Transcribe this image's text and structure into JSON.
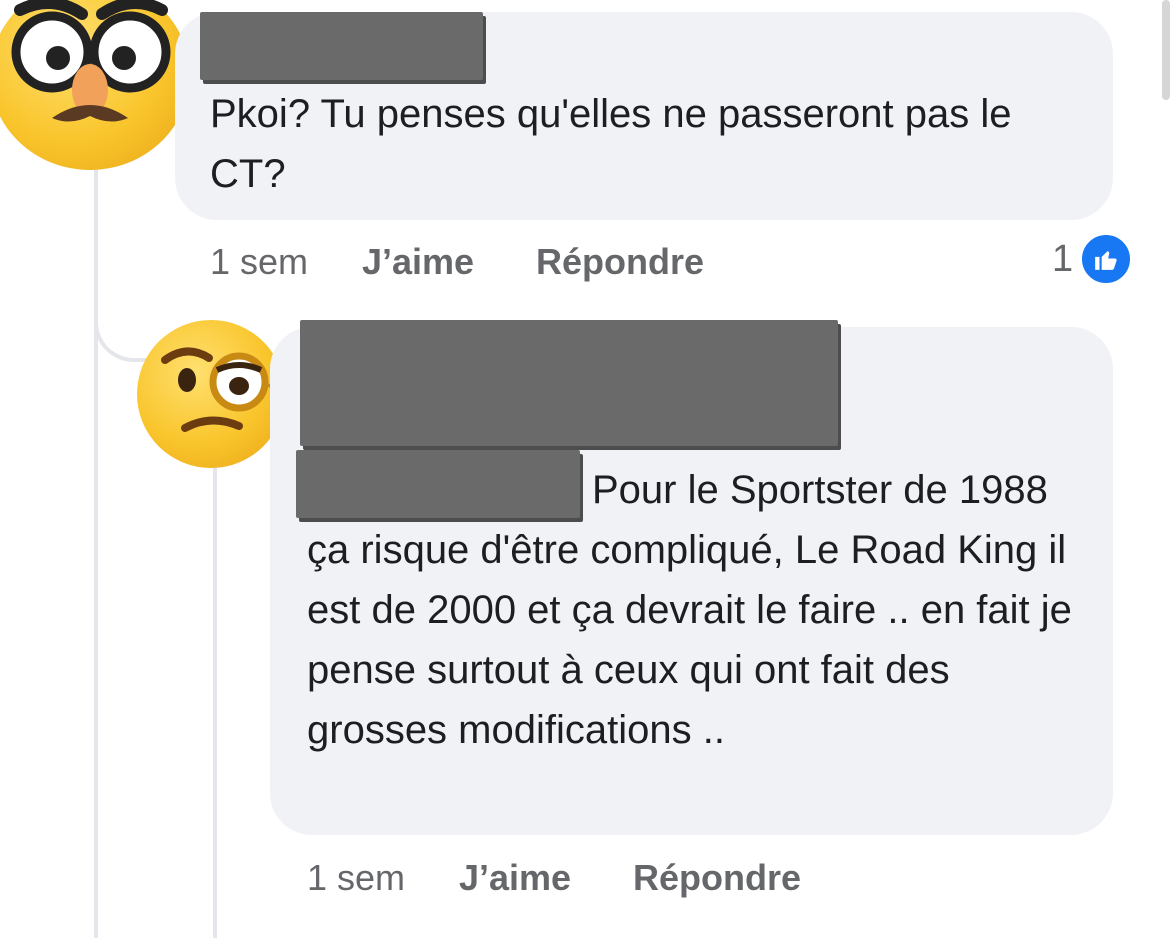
{
  "comment1": {
    "avatar_icon": "disguised-face-emoji",
    "text": "Pkoi? Tu penses qu'elles ne passeront pas le CT?",
    "time": "1 sem",
    "like_label": "J’aime",
    "reply_label": "Répondre",
    "reaction_count": "1",
    "reaction_icon": "thumbs-up-icon"
  },
  "comment2": {
    "avatar_icon": "face-with-monocle-emoji",
    "text": "Pour le Sportster de 1988 ça risque d'être compliqué, Le Road King il est de 2000 et ça devrait le faire .. en fait je pense surtout à ceux qui ont fait des grosses modifications ..",
    "time": "1 sem",
    "like_label": "J’aime",
    "reply_label": "Répondre"
  },
  "colors": {
    "bubble": "#f0f2f5",
    "secondary_text": "#65676b",
    "like_blue": "#1877f2",
    "redaction": "#6a6a6a"
  }
}
